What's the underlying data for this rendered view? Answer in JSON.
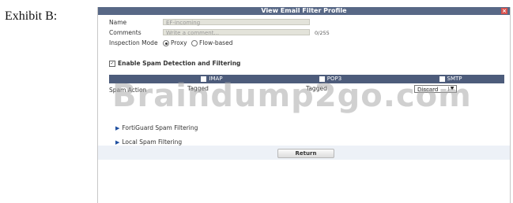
{
  "exhibit": {
    "label": "Exhibit B:"
  },
  "dialog": {
    "title": "View Email Filter Profile",
    "close_glyph": "×",
    "name_label": "Name",
    "name_value": "EF-incoming",
    "comments_label": "Comments",
    "comments_placeholder": "Write a comment...",
    "comments_counter": "0/255",
    "inspection_mode_label": "Inspection Mode",
    "inspection_modes": [
      {
        "label": "Proxy",
        "selected": true
      },
      {
        "label": "Flow-based",
        "selected": false
      }
    ],
    "spam_toggle_label": "Enable Spam Detection and Filtering",
    "table": {
      "columns": [
        "IMAP",
        "POP3",
        "SMTP"
      ],
      "row_label": "Spam Action",
      "imap_action": "Tagged",
      "pop3_action": "Tagged",
      "smtp_action": "Discard"
    },
    "expanders": [
      {
        "label": "FortiGuard Spam Filtering"
      },
      {
        "label": "Local Spam Filtering"
      }
    ],
    "return_label": "Return"
  },
  "watermark": {
    "text": "Braindump2go.com"
  },
  "colors": {
    "titlebar": "#586886",
    "table_header": "#4d5c7b",
    "close": "#d9534f"
  }
}
